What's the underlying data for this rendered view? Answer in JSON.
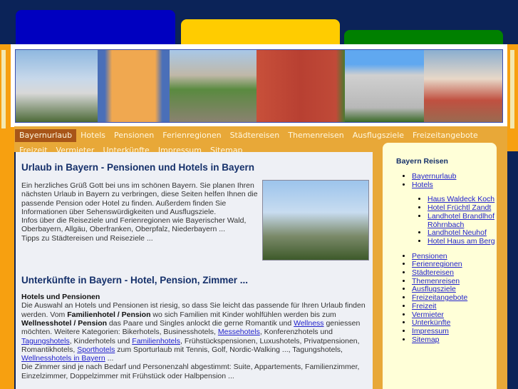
{
  "nav": [
    "Bayernurlaub",
    "Hotels",
    "Pensionen",
    "Ferienregionen",
    "Städtereisen",
    "Themenreisen",
    "Ausflugsziele",
    "Freizeitangebote",
    "Freizeit",
    "Vermieter",
    "Unterkünfte",
    "Impressum",
    "Sitemap"
  ],
  "section1": {
    "title": "Urlaub in Bayern - Pensionen und Hotels in Bayern",
    "lines": [
      "Ein herzliches Grüß Gott bei uns im schönen Bayern. Sie planen Ihren nächsten Urlaub in Bayern zu verbringen, diese Seiten helfen Ihnen die passende Pension oder Hotel zu finden. Außerdem finden Sie Informationen über Sehenswürdigkeiten und Ausflugsziele.",
      "Infos über die Reiseziele und Ferienregionen wie Bayerischer Wald, Oberbayern, Allgäu, Oberfranken, Oberpfalz, Niederbayern ...",
      "Tipps zu Städtereisen und Reiseziele ..."
    ]
  },
  "section2": {
    "title": "Unterkünfte in Bayern - Hotel, Pension, Zimmer ...",
    "subtitle": "Hotels und Pensionen",
    "t1": "Die Auswahl an Hotels und Pensionen ist riesig, so dass Sie leicht das passende für Ihren Urlaub finden werden. Vom ",
    "b1": "Familienhotel",
    "s1": " / ",
    "b2": "Pension",
    "t2": " wo sich Familien mit Kinder wohlfühlen werden bis zum ",
    "b3": "Wellnesshotel",
    "s2": " / ",
    "b4": "Pension",
    "t3": " das Paare und Singles anlockt die gerne Romantik und ",
    "l1": "Wellness",
    "t4": " geniessen möchten. Weitere Kategorien: Bikerhotels, Businesshotels, ",
    "l2": "Messehotels",
    "t5": ", Konferenzhotels und ",
    "l3": "Tagungshotels",
    "t6": ", Kinderhotels und ",
    "l4": "Familienhotels",
    "t7": ", Frühstückspensionen, Luxushotels, Privatpensionen, Romantikhotels, ",
    "l5": "Sporthotels",
    "t8": " zum Sporturlaub mit Tennis, Golf, Nordic-Walking ..., Tagungshotels, ",
    "l6": "Wellnesshotels in Bayern",
    "t9": " ...",
    "t10": "Die Zimmer sind je nach Bedarf und Personenzahl abgestimmt: Suite, Appartements, Familienzimmer, Einzelzimmer, Doppelzimmer mit Frühstück oder Halbpension ..."
  },
  "sidebar": {
    "title": "Bayern Reisen",
    "items": [
      "Bayernurlaub",
      "Hotels"
    ],
    "hotels": [
      "Haus Waldeck Koch",
      "Hotel Früchtl Zandt",
      "Landhotel Brandlhof Röhrnbach",
      "Landhotel Neuhof",
      "Hotel Haus am Berg"
    ],
    "more": [
      "Pensionen",
      "Ferienregionen",
      "Städtereisen",
      "Themenreisen",
      "Ausflugsziele",
      "Freizeitangebote",
      "Freizeit",
      "Vermieter",
      "Unterkünfte",
      "Impressum",
      "Sitemap"
    ]
  }
}
